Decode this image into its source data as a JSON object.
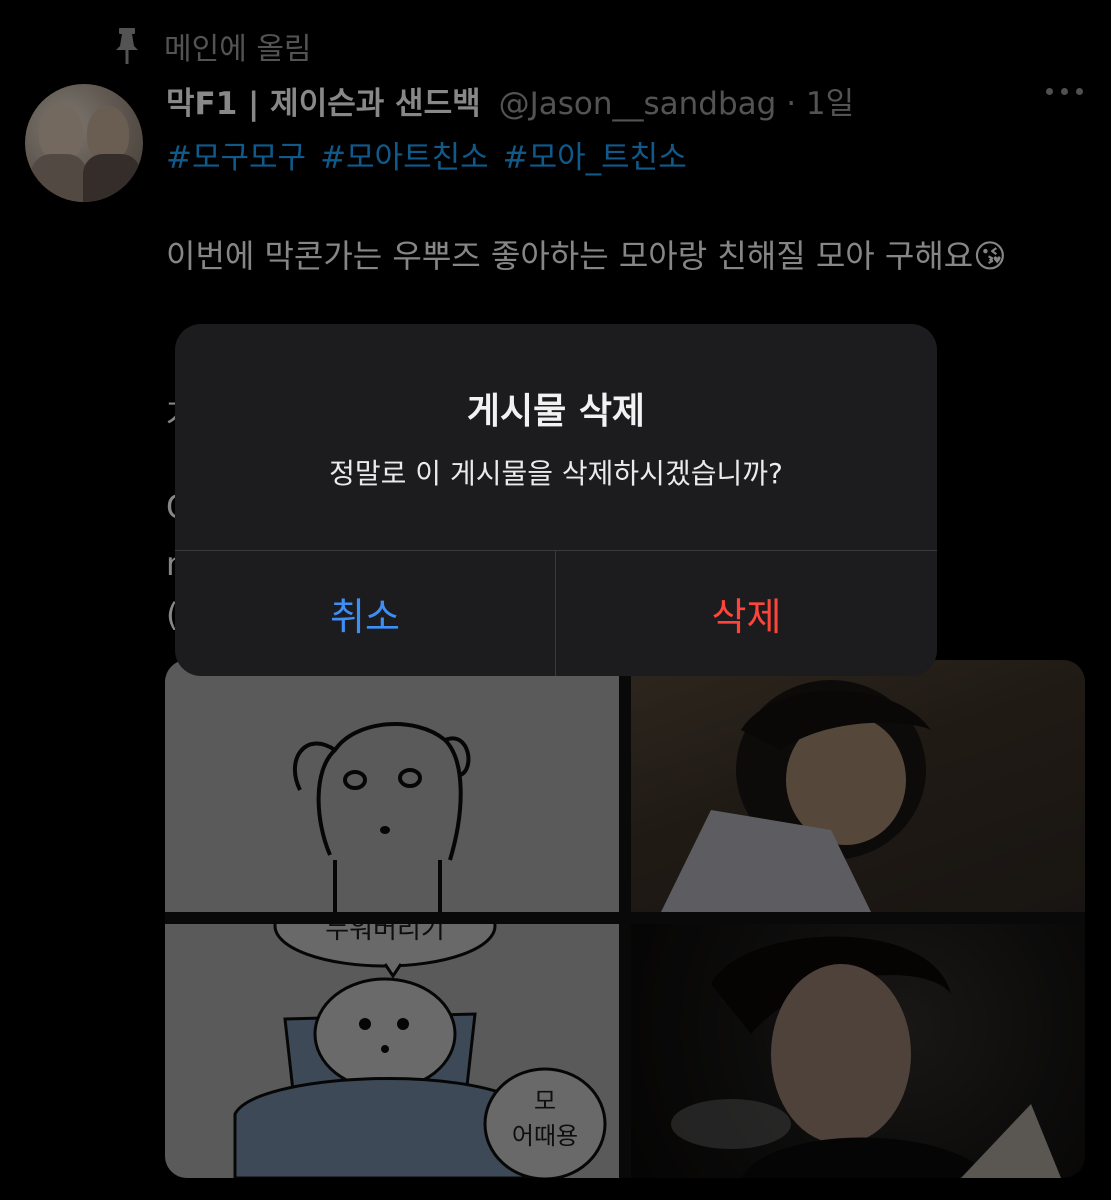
{
  "pinned": {
    "label": "메인에 올림",
    "icon": "pin-icon"
  },
  "tweet": {
    "display_name": "막F1 | 제이슨과 샌드백",
    "handle": "@Jason__sandbag · 1일",
    "hashtags": [
      "#모구모구",
      "#모아트친소",
      "#모아_트친소"
    ],
    "body": "이번에 막콘가는 우뿌즈 좋아하는 모아랑 친해질 모아 구해요😘",
    "partial_lines": [
      "겨",
      "C",
      "n",
      "("
    ]
  },
  "media": {
    "bubble_top": "누워버리기",
    "bubble_bottom_line1": "모",
    "bubble_bottom_line2": "어때용"
  },
  "dialog": {
    "title": "게시물 삭제",
    "message": "정말로 이 게시물을 삭제하시겠습니까?",
    "cancel_label": "취소",
    "delete_label": "삭제"
  },
  "colors": {
    "background": "#000000",
    "link": "#1d9bf0",
    "cancel": "#3e8ef7",
    "destructive": "#ff453a",
    "dialog_bg": "#1c1c1e"
  }
}
